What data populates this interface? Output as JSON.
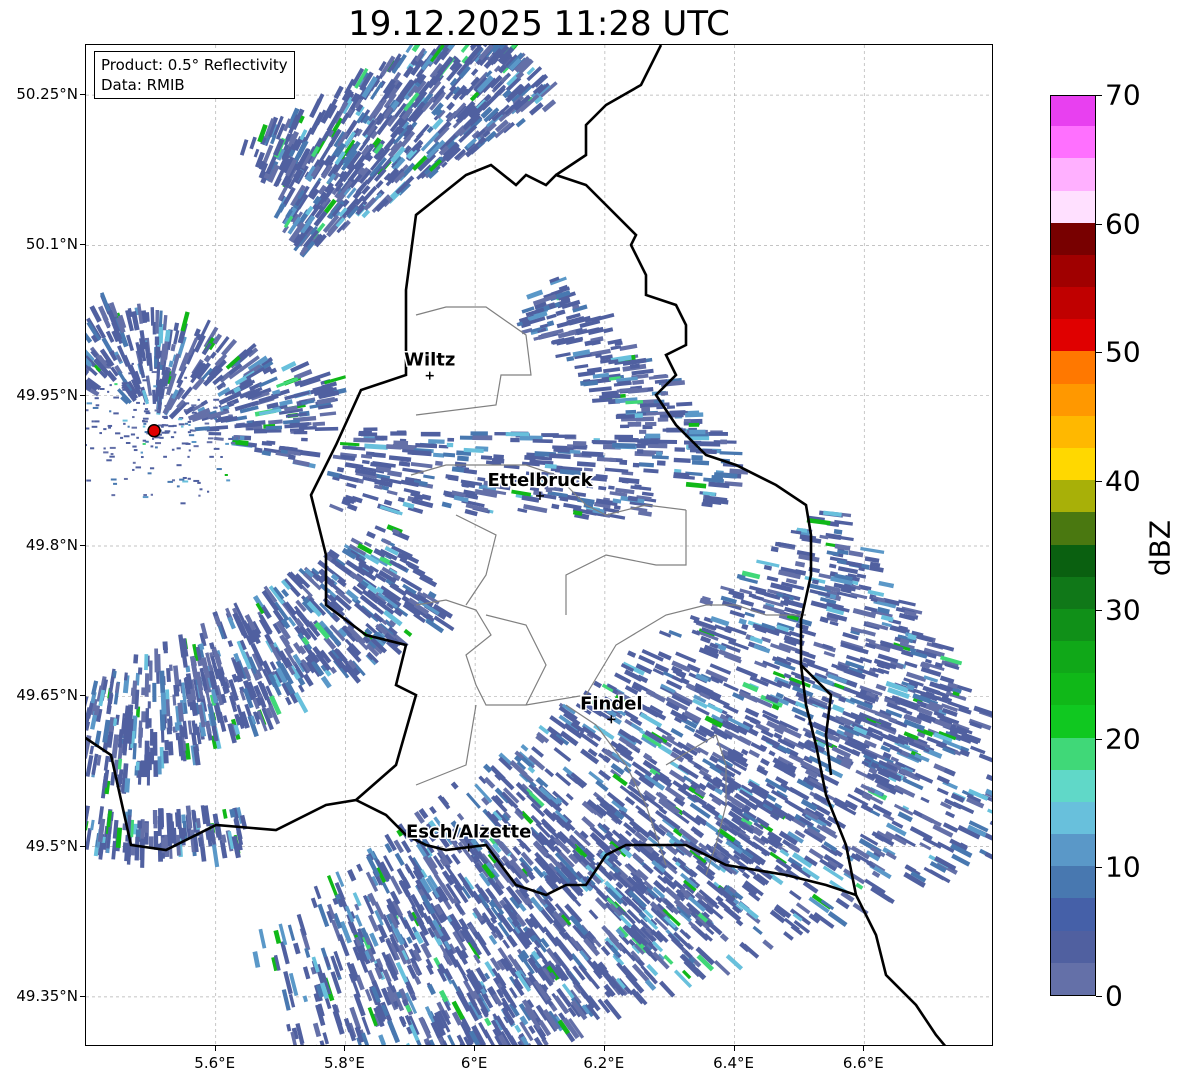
{
  "title": "19.12.2025 11:28 UTC",
  "info": {
    "product": "Product: 0.5° Reflectivity",
    "data": "Data: RMIB"
  },
  "axes": {
    "lon_ticks": [
      "5.6°E",
      "5.8°E",
      "6°E",
      "6.2°E",
      "6.4°E",
      "6.6°E"
    ],
    "lat_ticks": [
      "50.25°N",
      "50.1°N",
      "49.95°N",
      "49.8°N",
      "49.65°N",
      "49.5°N",
      "49.35°N"
    ],
    "lon_values": [
      5.6,
      5.8,
      6.0,
      6.2,
      6.4,
      6.6
    ],
    "lat_values": [
      50.25,
      50.1,
      49.95,
      49.8,
      49.65,
      49.5,
      49.35
    ],
    "lon_range": [
      5.4,
      6.8
    ],
    "lat_range": [
      49.3,
      50.3
    ]
  },
  "cities": [
    {
      "name": "Wiltz",
      "lon": 5.93,
      "lat": 49.97
    },
    {
      "name": "Ettelbruck",
      "lon": 6.1,
      "lat": 49.85
    },
    {
      "name": "Findel",
      "lon": 6.21,
      "lat": 49.627
    },
    {
      "name": "Esch/Alzette",
      "lon": 5.99,
      "lat": 49.499
    }
  ],
  "radar_site": {
    "lon": 5.505,
    "lat": 49.915
  },
  "colorbar": {
    "label": "dBZ",
    "min": 0,
    "max": 70,
    "tick_labels": [
      "0",
      "10",
      "20",
      "30",
      "40",
      "50",
      "60",
      "70"
    ],
    "colors": [
      "#6470a8",
      "#5060a0",
      "#4560a8",
      "#4878b0",
      "#5a98c8",
      "#68c0dc",
      "#60d8c8",
      "#40d878",
      "#10c820",
      "#10b818",
      "#10a818",
      "#109018",
      "#107818",
      "#0a6010",
      "#4a7810",
      "#a8b008",
      "#ffd800",
      "#ffb800",
      "#ff9800",
      "#ff7800",
      "#e00000",
      "#c00000",
      "#a00000",
      "#780000",
      "#ffe0ff",
      "#ffb0ff",
      "#ff70ff",
      "#e840f0"
    ]
  }
}
